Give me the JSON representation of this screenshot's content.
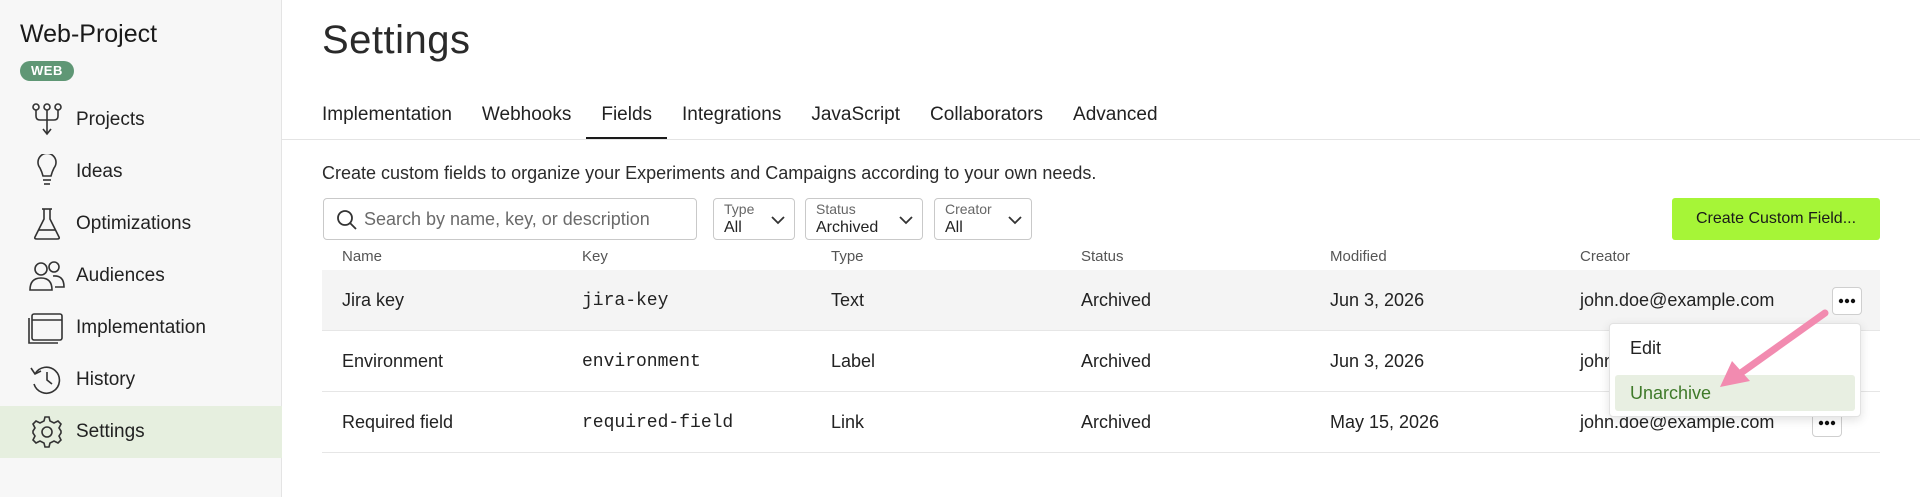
{
  "sidebar": {
    "project_name": "Web-Project",
    "badge": "WEB",
    "items": [
      {
        "label": "Projects",
        "icon": "projects-icon"
      },
      {
        "label": "Ideas",
        "icon": "lightbulb-icon"
      },
      {
        "label": "Optimizations",
        "icon": "flask-icon"
      },
      {
        "label": "Audiences",
        "icon": "users-icon"
      },
      {
        "label": "Implementation",
        "icon": "window-icon"
      },
      {
        "label": "History",
        "icon": "history-icon"
      },
      {
        "label": "Settings",
        "icon": "gear-icon",
        "active": true
      }
    ]
  },
  "page": {
    "title": "Settings",
    "tabs": [
      "Implementation",
      "Webhooks",
      "Fields",
      "Integrations",
      "JavaScript",
      "Collaborators",
      "Advanced"
    ],
    "active_tab": "Fields",
    "description": "Create custom fields to organize your Experiments and Campaigns according to your own needs."
  },
  "toolbar": {
    "search_placeholder": "Search by name, key, or description",
    "filters": [
      {
        "label": "Type",
        "value": "All"
      },
      {
        "label": "Status",
        "value": "Archived"
      },
      {
        "label": "Creator",
        "value": "All"
      }
    ],
    "create_label": "Create Custom Field..."
  },
  "table": {
    "columns": [
      "Name",
      "Key",
      "Type",
      "Status",
      "Modified",
      "Creator"
    ],
    "rows": [
      {
        "name": "Jira key",
        "key": "jira-key",
        "type": "Text",
        "status": "Archived",
        "modified": "Jun 3, 2026",
        "creator": "john.doe@example.com"
      },
      {
        "name": "Environment",
        "key": "environment",
        "type": "Label",
        "status": "Archived",
        "modified": "Jun 3, 2026",
        "creator": "john"
      },
      {
        "name": "Required field",
        "key": "required-field",
        "type": "Link",
        "status": "Archived",
        "modified": "May 15, 2026",
        "creator": "john.doe@example.com"
      }
    ]
  },
  "menu": {
    "items": [
      "Edit",
      "Unarchive"
    ]
  },
  "colors": {
    "accent": "#a6f537",
    "badge": "#5f9775",
    "active_nav": "#e6efdf",
    "menu_highlight": "#e8efe2",
    "arrow": "#f28bb0"
  }
}
